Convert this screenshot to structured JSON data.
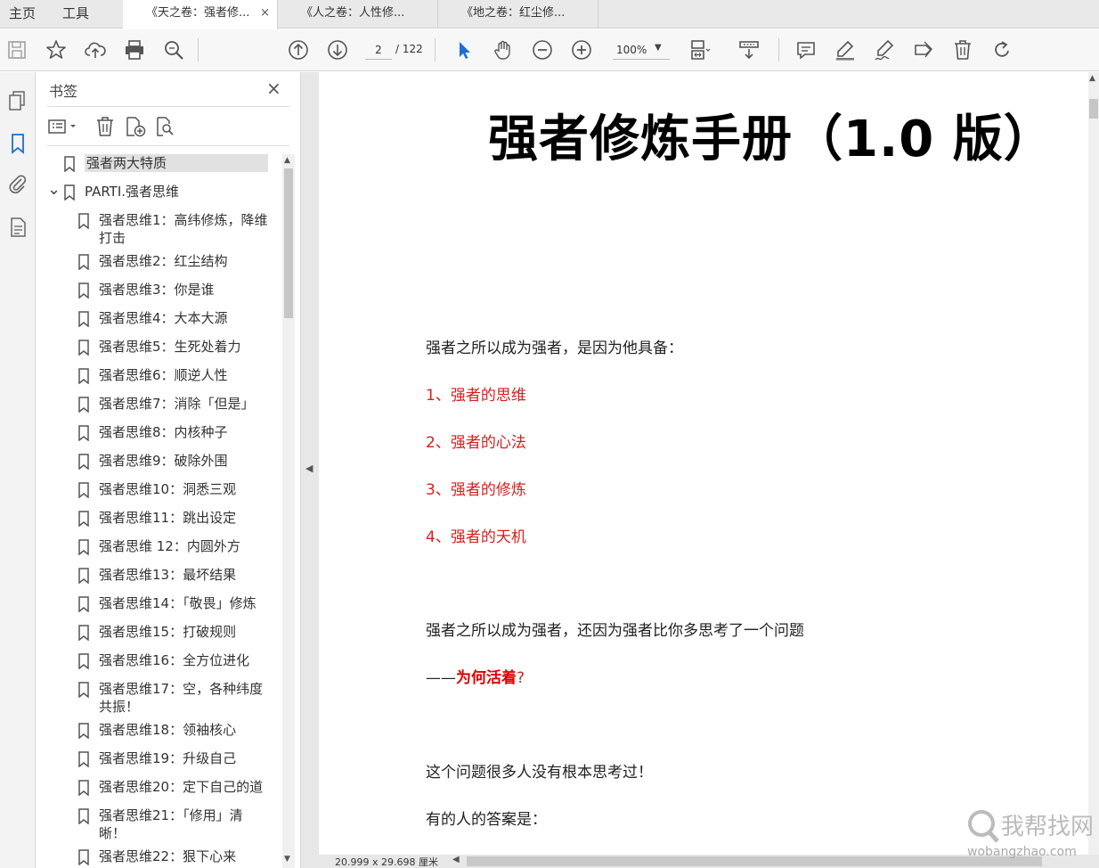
{
  "menu": {
    "home": "主页",
    "tools": "工具"
  },
  "tabs": [
    {
      "label": "《天之卷：强者修...",
      "active": true,
      "close": "×"
    },
    {
      "label": "《人之卷：人性修...",
      "active": false
    },
    {
      "label": "《地之卷：红尘修...",
      "active": false
    }
  ],
  "toolbar": {
    "icons": [
      "save-icon",
      "star-icon",
      "upload-icon",
      "print-icon",
      "search-icon",
      "prev-page-icon",
      "next-page-icon",
      "select-icon",
      "hand-icon",
      "zoom-out-icon",
      "zoom-in-icon",
      "fit-page-icon",
      "scroll-mode-icon",
      "comment-icon",
      "highlight-icon",
      "sign-icon",
      "fill-sign-icon",
      "delete-icon",
      "rotate-icon"
    ],
    "page_current": "2",
    "page_total": "/ 122",
    "zoom": "100%"
  },
  "panel": {
    "title": "书签",
    "close": "×"
  },
  "bookmarks": [
    {
      "label": "强者两大特质",
      "level": 0
    },
    {
      "label": "PARTI.强者思维",
      "level": 0,
      "expanded": true
    },
    {
      "label": "强者思维1：高纬修炼，降维打击",
      "level": 1
    },
    {
      "label": "强者思维2：红尘结构",
      "level": 1
    },
    {
      "label": "强者思维3：你是谁",
      "level": 1
    },
    {
      "label": "强者思维4：大本大源",
      "level": 1
    },
    {
      "label": "强者思维5：生死处着力",
      "level": 1
    },
    {
      "label": "强者思维6：顺逆人性",
      "level": 1
    },
    {
      "label": "强者思维7：消除「但是」",
      "level": 1
    },
    {
      "label": "强者思维8：内核种子",
      "level": 1
    },
    {
      "label": "强者思维9：破除外围",
      "level": 1
    },
    {
      "label": "强者思维10：洞悉三观",
      "level": 1
    },
    {
      "label": "强者思维11：跳出设定",
      "level": 1
    },
    {
      "label": "强者思维 12：内圆外方",
      "level": 1
    },
    {
      "label": "强者思维13：最坏结果",
      "level": 1
    },
    {
      "label": "强者思维14：「敬畏」修炼",
      "level": 1
    },
    {
      "label": "强者思维15：打破规则",
      "level": 1
    },
    {
      "label": "强者思维16：全方位进化",
      "level": 1
    },
    {
      "label": "强者思维17：空，各种纬度共振！",
      "level": 1
    },
    {
      "label": "强者思维18：领袖核心",
      "level": 1
    },
    {
      "label": "强者思维19：升级自己",
      "level": 1
    },
    {
      "label": "强者思维20：定下自己的道",
      "level": 1
    },
    {
      "label": "强者思维21：「修用」清晰！",
      "level": 1
    },
    {
      "label": "强者思维22：狠下心来",
      "level": 1
    }
  ],
  "document": {
    "title": "强者修炼手册（1.0 版）",
    "intro": "强者之所以成为强者，是因为他具备：",
    "list": [
      "1、强者的思维",
      "2、强者的心法",
      "3、强者的修炼",
      "4、强者的天机"
    ],
    "para2": "强者之所以成为强者，还因为强者比你多思考了一个问题",
    "dash": "——",
    "question": "为何活着",
    "question_mark": "?",
    "para3": "这个问题很多人没有根本思考过！",
    "para4": "有的人的答案是："
  },
  "status": {
    "page_size": "20.999 x 29.698 厘米"
  },
  "watermark": {
    "text": "我帮找网",
    "url": "wobangzhao.com"
  }
}
